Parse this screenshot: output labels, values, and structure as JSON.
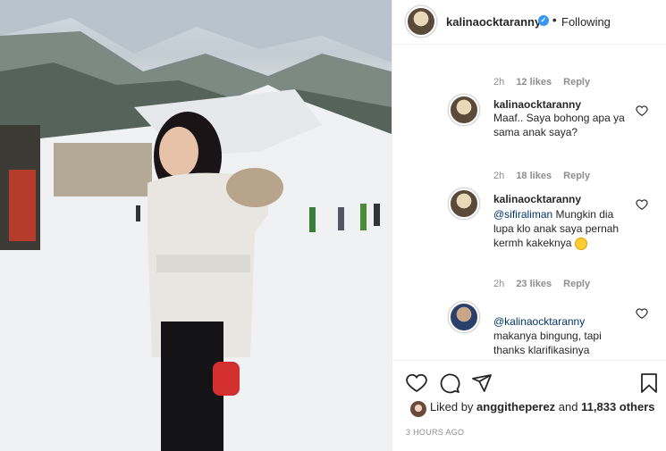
{
  "post": {
    "author": "kalinaocktaranny",
    "follow_status": "Following",
    "separator": "•"
  },
  "comments": [
    {
      "meta_time": "2h",
      "meta_likes": "12 likes",
      "meta_reply": "Reply"
    },
    {
      "author": "kalinaocktaranny",
      "text": "Maaf.. Saya bohong apa ya sama anak saya?",
      "meta_time": "2h",
      "meta_likes": "18 likes",
      "meta_reply": "Reply"
    },
    {
      "author": "kalinaocktaranny",
      "mention": "@sifiraliman",
      "text": "Mungkin dia lupa klo anak saya pernah kermh kakeknya",
      "meta_time": "2h",
      "meta_likes": "23 likes",
      "meta_reply": "Reply"
    },
    {
      "mention": "@kalinaocktaranny",
      "text": "makanya bingung, tapi thanks klarifikasinya"
    }
  ],
  "likes": {
    "prefix": "Liked by",
    "user": "anggitheperez",
    "suffix": "and",
    "count": "11,833 others"
  },
  "timestamp": "3 HOURS AGO",
  "icons": [
    "heart-icon",
    "comment-icon",
    "share-icon",
    "bookmark-icon",
    "verified-badge-icon",
    "smile-emoji"
  ],
  "colors": {
    "verified": "#3897f0",
    "mention": "#003569",
    "glove": "#d32f2f"
  }
}
